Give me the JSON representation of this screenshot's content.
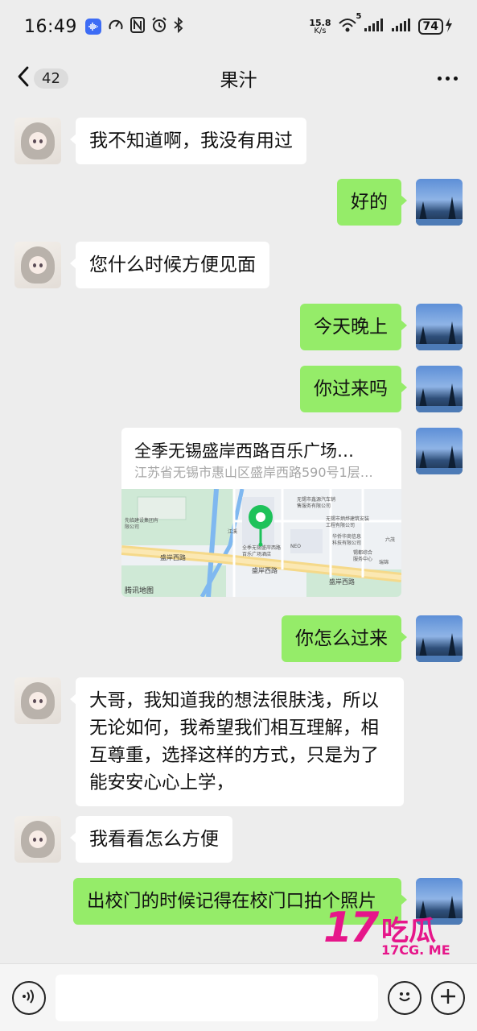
{
  "status_bar": {
    "time": "16:49",
    "net_speed_value": "15.8",
    "net_speed_unit": "K/s",
    "wifi_badge": "5",
    "battery": "74",
    "icons": [
      "voice-app-icon",
      "speedometer-icon",
      "nfc-icon",
      "alarm-icon",
      "bluetooth-icon",
      "wifi-icon",
      "signal-icon",
      "signal-icon",
      "charging-icon"
    ]
  },
  "nav": {
    "title": "果汁",
    "unread_count": "42",
    "icons": [
      "chevron-left-icon",
      "more-icon"
    ]
  },
  "messages": [
    {
      "side": "other",
      "text": "我不知道啊，我没有用过"
    },
    {
      "side": "self",
      "text": "好的"
    },
    {
      "side": "other",
      "text": "您什么时候方便见面"
    },
    {
      "side": "self",
      "text": "今天晚上"
    },
    {
      "side": "self",
      "text": "你过来吗"
    },
    {
      "side": "self",
      "type": "location",
      "title": "全季无锡盛岸西路百乐广场…",
      "address": "江苏省无锡市惠山区盛岸西路590号1层…",
      "map_labels": [
        "盛岸西路",
        "盛岸西路",
        "盛岸西路",
        "腾讯地图",
        "先临建设集团有限公司",
        "无锡市鑫源汽车销售服务有限公司",
        "无锡市炳烨建筑安装工程有限公司",
        "全季无锡盛岸西路百乐广场酒店",
        "NEO",
        "华侨华商信息科技有限公司",
        "锡都综合服务中心",
        "六茂",
        "瑞锦",
        "江溪"
      ]
    },
    {
      "side": "self",
      "text": "你怎么过来"
    },
    {
      "side": "other",
      "text": "大哥，我知道我的想法很肤浅，所以无论如何，我希望我们相互理解，相互尊重，选择这样的方式，只是为了能安安心心上学，"
    },
    {
      "side": "other",
      "text": "我看看怎么方便"
    },
    {
      "side": "self",
      "text": "出校门的时候记得在校门口拍个照片"
    }
  ],
  "input_bar": {
    "placeholder": "",
    "icons": [
      "voice-icon",
      "emoji-icon",
      "plus-icon"
    ]
  },
  "watermark": {
    "number": "17",
    "text": "吃瓜",
    "site": "17CG. ME"
  },
  "colors": {
    "background": "#ededed",
    "bubble_self": "#95ec69",
    "bubble_other": "#ffffff",
    "watermark": "#e6168a"
  }
}
